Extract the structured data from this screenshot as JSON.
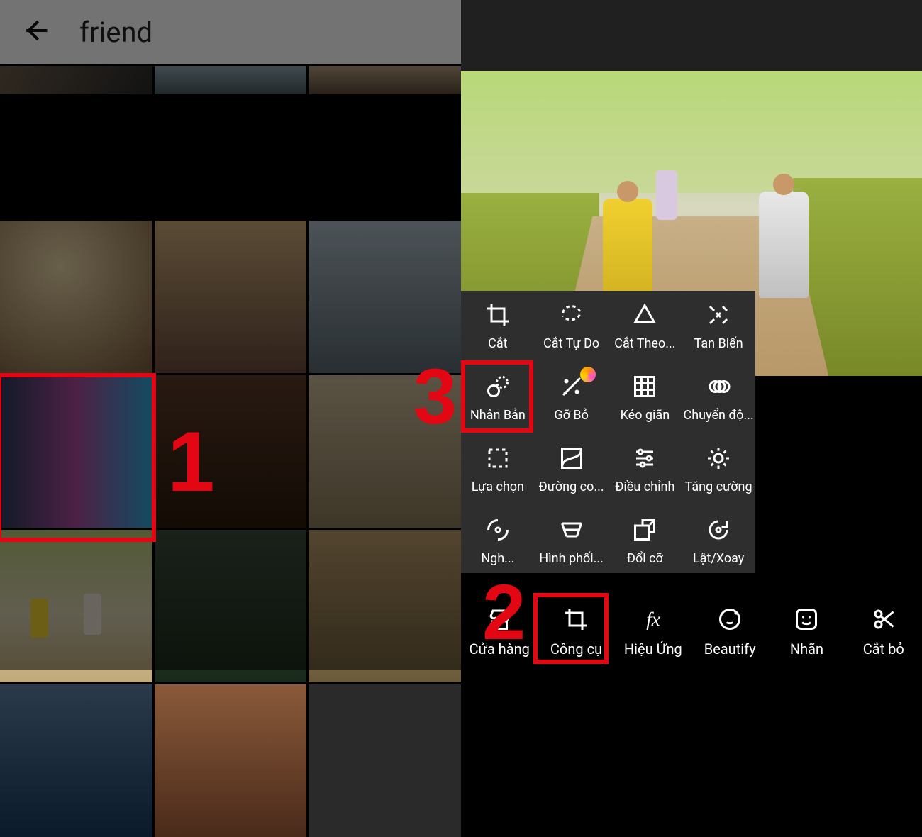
{
  "left": {
    "search_query": "friend",
    "selected_index": 9,
    "step1_label": "1"
  },
  "right": {
    "step2_label": "2",
    "step3_label": "3",
    "tools": [
      {
        "label": "Cắt",
        "icon": "crop-icon"
      },
      {
        "label": "Cắt Tự Do",
        "icon": "lasso-icon"
      },
      {
        "label": "Cắt Theo...",
        "icon": "shape-cut-icon"
      },
      {
        "label": "Tan Biến",
        "icon": "disperse-icon"
      },
      {
        "label": "Nhân Bản",
        "icon": "clone-icon",
        "highlighted": true
      },
      {
        "label": "Gỡ Bỏ",
        "icon": "remove-icon",
        "premium": true
      },
      {
        "label": "Kéo giãn",
        "icon": "stretch-icon"
      },
      {
        "label": "Chuyển độ...",
        "icon": "motion-icon"
      },
      {
        "label": "Lựa chọn",
        "icon": "selection-icon"
      },
      {
        "label": "Đường co...",
        "icon": "curves-icon"
      },
      {
        "label": "Điều chỉnh",
        "icon": "adjust-icon"
      },
      {
        "label": "Tăng cường",
        "icon": "enhance-icon"
      },
      {
        "label": "Ngh...",
        "icon": "tilt-icon"
      },
      {
        "label": "Hình phối...",
        "icon": "perspective-icon"
      },
      {
        "label": "Đổi cỡ",
        "icon": "resize-icon"
      },
      {
        "label": "Lật/Xoay",
        "icon": "flip-rotate-icon"
      }
    ],
    "bottom_tabs": [
      {
        "label": "Cửa hàng",
        "icon": "shop-icon"
      },
      {
        "label": "Công cụ",
        "icon": "tools-tab-icon",
        "highlighted": true
      },
      {
        "label": "Hiệu Ứng",
        "icon": "fx-icon"
      },
      {
        "label": "Beautify",
        "icon": "beautify-icon"
      },
      {
        "label": "Nhãn",
        "icon": "sticker-icon"
      },
      {
        "label": "Cắt bỏ",
        "icon": "cutout-icon"
      }
    ]
  },
  "colors": {
    "accent": "#e30613"
  }
}
